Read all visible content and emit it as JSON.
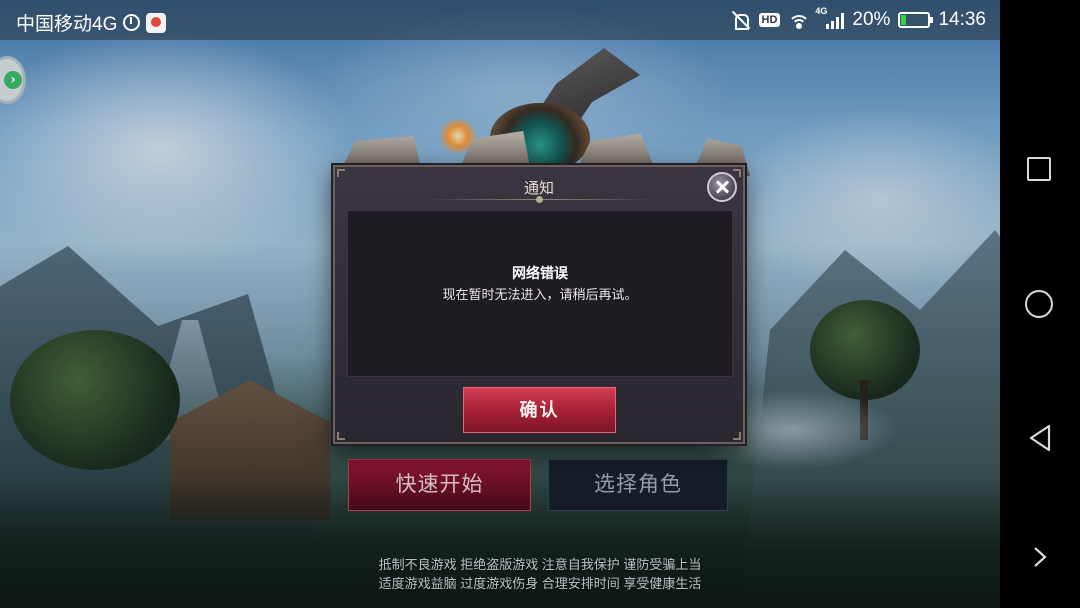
{
  "status_bar": {
    "carrier": "中国移动4G",
    "network_badge": "HD",
    "cell_type": "4G",
    "battery": "20%",
    "battery_level": 0.2,
    "time": "14:36",
    "icons": [
      "clock-icon",
      "app-notification-icon",
      "mute-icon",
      "hd-voice-icon",
      "wifi-icon",
      "cell-signal-icon",
      "battery-icon"
    ]
  },
  "dialog": {
    "title": "通知",
    "heading": "网络错误",
    "message": "现在暂时无法进入，请稍后再试。",
    "confirm_label": "确认",
    "close_icon": "close-icon"
  },
  "main": {
    "quick_start_label": "快速开始",
    "select_role_label": "选择角色",
    "health_notice_line1": "抵制不良游戏 拒绝盗版游戏 注意自我保护 谨防受骗上当",
    "health_notice_line2": "适度游戏益脑 过度游戏伤身 合理安排时间 享受健康生活"
  },
  "nav_bar": {
    "icons": [
      "recent-apps-icon",
      "home-icon",
      "back-icon",
      "chevron-right-icon"
    ]
  },
  "colors": {
    "primary_button": "#a41f35",
    "dialog_bg": "#2b2730",
    "battery_fill": "#38d04a"
  }
}
